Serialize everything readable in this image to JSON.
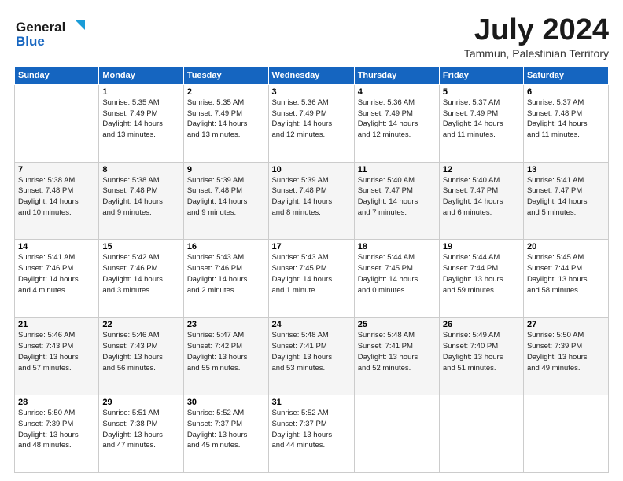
{
  "header": {
    "logo": {
      "line1": "General",
      "line2": "Blue"
    },
    "title": "July 2024",
    "subtitle": "Tammun, Palestinian Territory"
  },
  "calendar": {
    "headers": [
      "Sunday",
      "Monday",
      "Tuesday",
      "Wednesday",
      "Thursday",
      "Friday",
      "Saturday"
    ],
    "weeks": [
      [
        {
          "day": "",
          "info": ""
        },
        {
          "day": "1",
          "info": "Sunrise: 5:35 AM\nSunset: 7:49 PM\nDaylight: 14 hours\nand 13 minutes."
        },
        {
          "day": "2",
          "info": "Sunrise: 5:35 AM\nSunset: 7:49 PM\nDaylight: 14 hours\nand 13 minutes."
        },
        {
          "day": "3",
          "info": "Sunrise: 5:36 AM\nSunset: 7:49 PM\nDaylight: 14 hours\nand 12 minutes."
        },
        {
          "day": "4",
          "info": "Sunrise: 5:36 AM\nSunset: 7:49 PM\nDaylight: 14 hours\nand 12 minutes."
        },
        {
          "day": "5",
          "info": "Sunrise: 5:37 AM\nSunset: 7:49 PM\nDaylight: 14 hours\nand 11 minutes."
        },
        {
          "day": "6",
          "info": "Sunrise: 5:37 AM\nSunset: 7:48 PM\nDaylight: 14 hours\nand 11 minutes."
        }
      ],
      [
        {
          "day": "7",
          "info": "Sunrise: 5:38 AM\nSunset: 7:48 PM\nDaylight: 14 hours\nand 10 minutes."
        },
        {
          "day": "8",
          "info": "Sunrise: 5:38 AM\nSunset: 7:48 PM\nDaylight: 14 hours\nand 9 minutes."
        },
        {
          "day": "9",
          "info": "Sunrise: 5:39 AM\nSunset: 7:48 PM\nDaylight: 14 hours\nand 9 minutes."
        },
        {
          "day": "10",
          "info": "Sunrise: 5:39 AM\nSunset: 7:48 PM\nDaylight: 14 hours\nand 8 minutes."
        },
        {
          "day": "11",
          "info": "Sunrise: 5:40 AM\nSunset: 7:47 PM\nDaylight: 14 hours\nand 7 minutes."
        },
        {
          "day": "12",
          "info": "Sunrise: 5:40 AM\nSunset: 7:47 PM\nDaylight: 14 hours\nand 6 minutes."
        },
        {
          "day": "13",
          "info": "Sunrise: 5:41 AM\nSunset: 7:47 PM\nDaylight: 14 hours\nand 5 minutes."
        }
      ],
      [
        {
          "day": "14",
          "info": "Sunrise: 5:41 AM\nSunset: 7:46 PM\nDaylight: 14 hours\nand 4 minutes."
        },
        {
          "day": "15",
          "info": "Sunrise: 5:42 AM\nSunset: 7:46 PM\nDaylight: 14 hours\nand 3 minutes."
        },
        {
          "day": "16",
          "info": "Sunrise: 5:43 AM\nSunset: 7:46 PM\nDaylight: 14 hours\nand 2 minutes."
        },
        {
          "day": "17",
          "info": "Sunrise: 5:43 AM\nSunset: 7:45 PM\nDaylight: 14 hours\nand 1 minute."
        },
        {
          "day": "18",
          "info": "Sunrise: 5:44 AM\nSunset: 7:45 PM\nDaylight: 14 hours\nand 0 minutes."
        },
        {
          "day": "19",
          "info": "Sunrise: 5:44 AM\nSunset: 7:44 PM\nDaylight: 13 hours\nand 59 minutes."
        },
        {
          "day": "20",
          "info": "Sunrise: 5:45 AM\nSunset: 7:44 PM\nDaylight: 13 hours\nand 58 minutes."
        }
      ],
      [
        {
          "day": "21",
          "info": "Sunrise: 5:46 AM\nSunset: 7:43 PM\nDaylight: 13 hours\nand 57 minutes."
        },
        {
          "day": "22",
          "info": "Sunrise: 5:46 AM\nSunset: 7:43 PM\nDaylight: 13 hours\nand 56 minutes."
        },
        {
          "day": "23",
          "info": "Sunrise: 5:47 AM\nSunset: 7:42 PM\nDaylight: 13 hours\nand 55 minutes."
        },
        {
          "day": "24",
          "info": "Sunrise: 5:48 AM\nSunset: 7:41 PM\nDaylight: 13 hours\nand 53 minutes."
        },
        {
          "day": "25",
          "info": "Sunrise: 5:48 AM\nSunset: 7:41 PM\nDaylight: 13 hours\nand 52 minutes."
        },
        {
          "day": "26",
          "info": "Sunrise: 5:49 AM\nSunset: 7:40 PM\nDaylight: 13 hours\nand 51 minutes."
        },
        {
          "day": "27",
          "info": "Sunrise: 5:50 AM\nSunset: 7:39 PM\nDaylight: 13 hours\nand 49 minutes."
        }
      ],
      [
        {
          "day": "28",
          "info": "Sunrise: 5:50 AM\nSunset: 7:39 PM\nDaylight: 13 hours\nand 48 minutes."
        },
        {
          "day": "29",
          "info": "Sunrise: 5:51 AM\nSunset: 7:38 PM\nDaylight: 13 hours\nand 47 minutes."
        },
        {
          "day": "30",
          "info": "Sunrise: 5:52 AM\nSunset: 7:37 PM\nDaylight: 13 hours\nand 45 minutes."
        },
        {
          "day": "31",
          "info": "Sunrise: 5:52 AM\nSunset: 7:37 PM\nDaylight: 13 hours\nand 44 minutes."
        },
        {
          "day": "",
          "info": ""
        },
        {
          "day": "",
          "info": ""
        },
        {
          "day": "",
          "info": ""
        }
      ]
    ]
  }
}
